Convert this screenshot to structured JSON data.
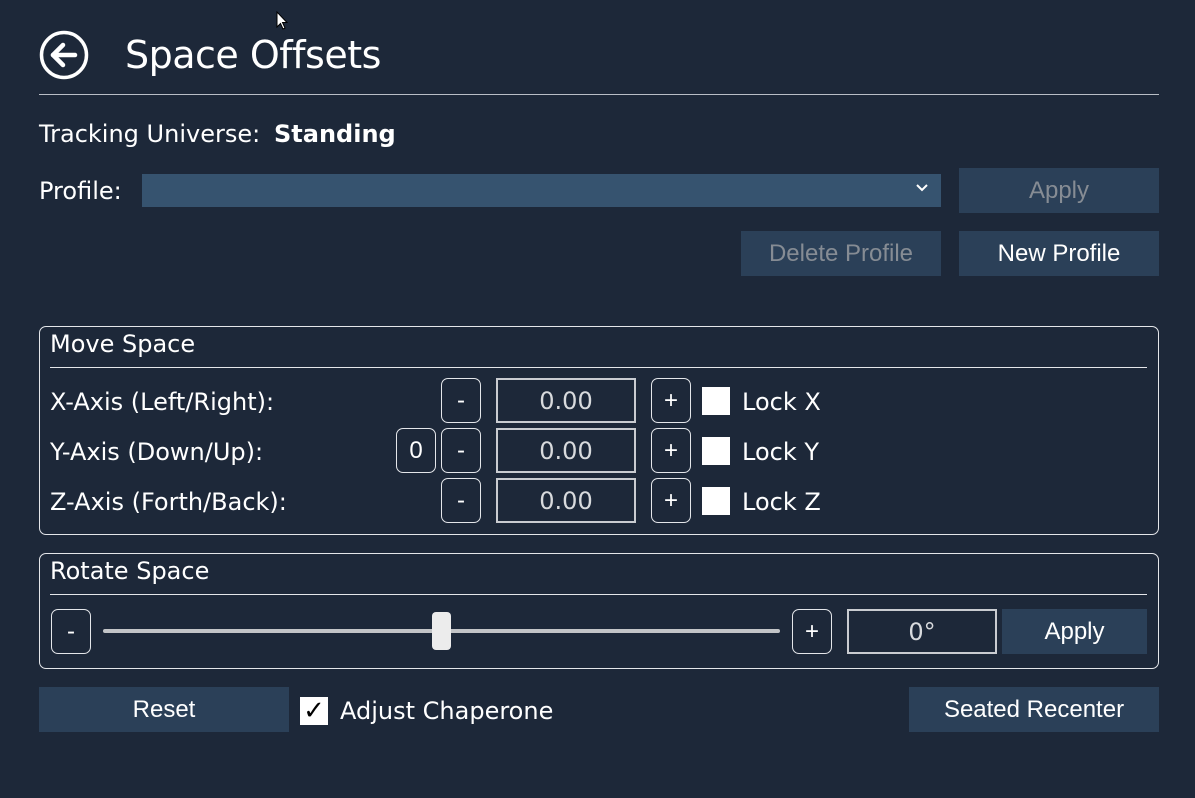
{
  "header": {
    "title": "Space Offsets",
    "back_icon": "back-arrow-circle-icon"
  },
  "tracking": {
    "label": "Tracking Universe:",
    "value": "Standing"
  },
  "profile": {
    "label": "Profile:",
    "selected": "",
    "apply_label": "Apply",
    "delete_label": "Delete Profile",
    "new_label": "New Profile"
  },
  "move_space": {
    "title": "Move Space",
    "axes": [
      {
        "label": "X-Axis (Left/Right):",
        "value": "0.00",
        "minus": "-",
        "plus": "+",
        "lock_label": "Lock X",
        "locked": false
      },
      {
        "label": "Y-Axis (Down/Up):",
        "value": "0.00",
        "minus": "-",
        "plus": "+",
        "lock_label": "Lock Y",
        "locked": false,
        "zero_label": "0"
      },
      {
        "label": "Z-Axis (Forth/Back):",
        "value": "0.00",
        "minus": "-",
        "plus": "+",
        "lock_label": "Lock Z",
        "locked": false
      }
    ]
  },
  "rotate_space": {
    "title": "Rotate Space",
    "minus": "-",
    "plus": "+",
    "slider_fraction": 0.5,
    "value": "0°",
    "apply_label": "Apply"
  },
  "footer": {
    "reset_label": "Reset",
    "adjust_chaperone_label": "Adjust Chaperone",
    "adjust_chaperone_checked": true,
    "check_glyph": "✓",
    "seated_recenter_label": "Seated Recenter"
  },
  "colors": {
    "background": "#1d2839",
    "button": "#2b4058",
    "select": "#36536f"
  }
}
